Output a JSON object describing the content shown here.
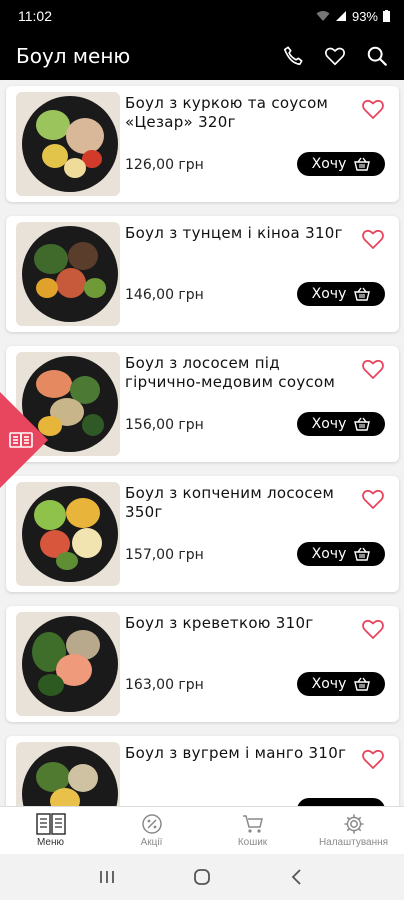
{
  "status": {
    "time": "11:02",
    "battery": "93%"
  },
  "app_bar": {
    "title": "Боул меню"
  },
  "products": [
    {
      "title": "Боул з куркою та соусом «Цезар» 320г",
      "price": "126,00 грн",
      "button": "Хочу"
    },
    {
      "title": "Боул з тунцем і кіноа 310г",
      "price": "146,00 грн",
      "button": "Хочу"
    },
    {
      "title": "Боул з лососем під гірчично-медовим соусом",
      "price": "156,00 грн",
      "button": "Хочу"
    },
    {
      "title": "Боул з копченим лососем 350г",
      "price": "157,00 грн",
      "button": "Хочу"
    },
    {
      "title": "Боул з креветкою 310г",
      "price": "163,00 грн",
      "button": "Хочу"
    },
    {
      "title": "Боул з вугрем і манго 310г",
      "price": "",
      "button": ""
    }
  ],
  "bottom_nav": [
    {
      "label": "Меню",
      "icon": "menu-book-icon",
      "active": true
    },
    {
      "label": "Акції",
      "icon": "percent-icon",
      "active": false
    },
    {
      "label": "Кошик",
      "icon": "cart-icon",
      "active": false
    },
    {
      "label": "Налаштування",
      "icon": "gear-icon",
      "active": false
    }
  ],
  "colors": {
    "accent": "#e8455f",
    "bar": "#000000"
  }
}
